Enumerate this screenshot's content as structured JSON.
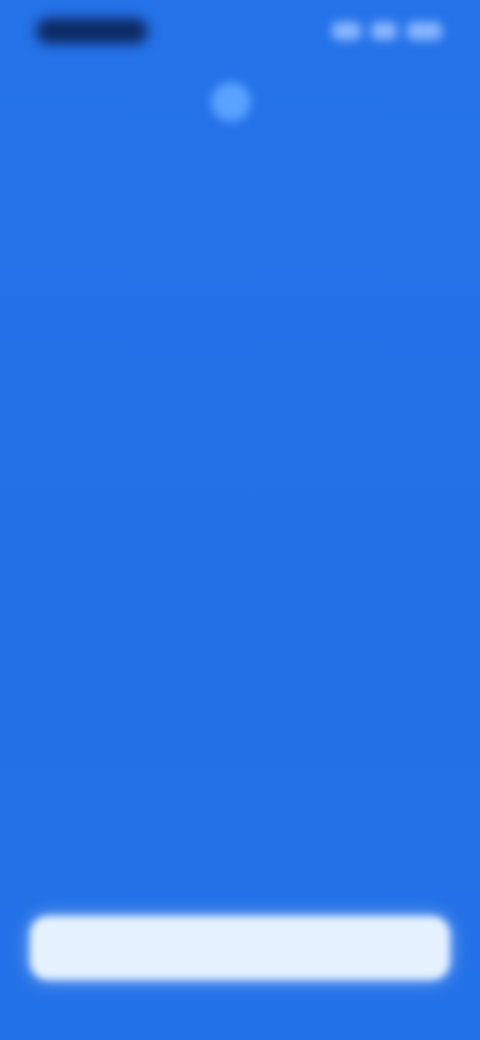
{
  "status_bar": {
    "time": "",
    "icons": [
      "signal-icon",
      "wifi-icon",
      "battery-icon"
    ]
  },
  "app": {
    "name": "",
    "logo_icon": "app-logo-icon"
  },
  "main": {
    "headline": "",
    "subtitle": ""
  },
  "cta": {
    "label": ""
  },
  "colors": {
    "background": "#2370e8",
    "button": "#e6f2ff"
  }
}
